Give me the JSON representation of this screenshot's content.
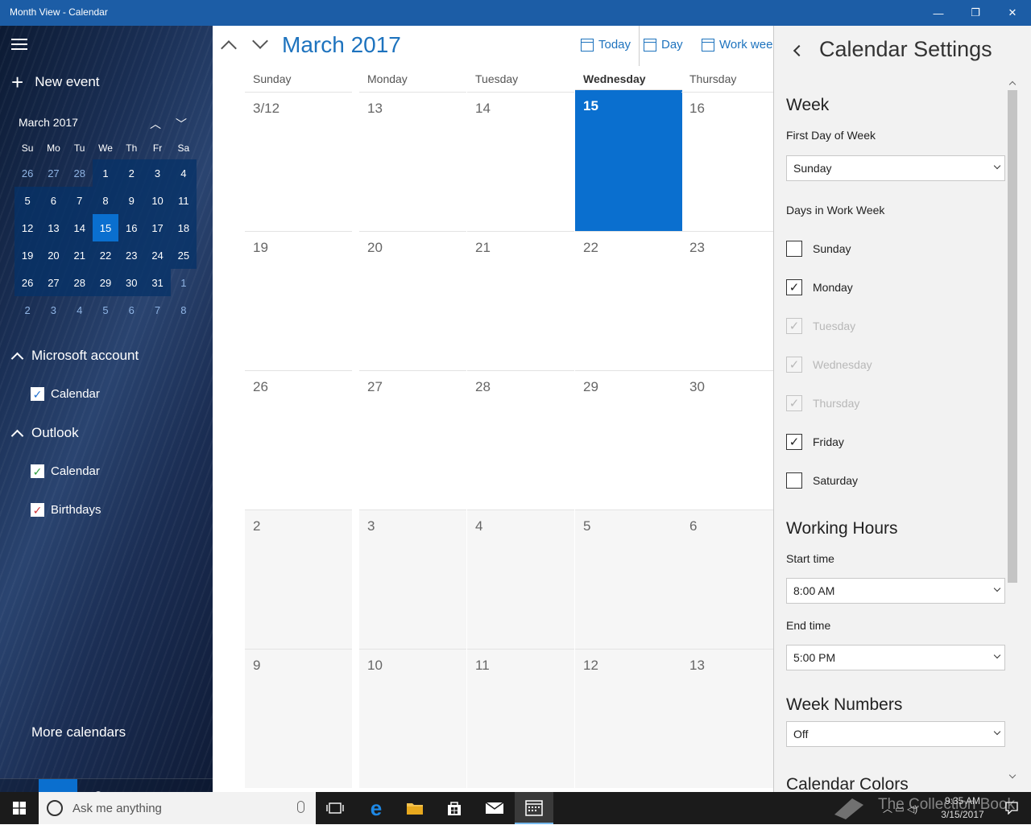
{
  "window": {
    "title": "Month View - Calendar",
    "minimize": "—",
    "restore": "❐",
    "close": "✕"
  },
  "sidebar": {
    "new_event": "New event",
    "mini_calendar": {
      "title": "March 2017",
      "prev": "︿",
      "next": "﹀",
      "weekdays": [
        "Su",
        "Mo",
        "Tu",
        "We",
        "Th",
        "Fr",
        "Sa"
      ],
      "weeks": [
        [
          "26",
          "27",
          "28",
          "1",
          "2",
          "3",
          "4"
        ],
        [
          "5",
          "6",
          "7",
          "8",
          "9",
          "10",
          "11"
        ],
        [
          "12",
          "13",
          "14",
          "15",
          "16",
          "17",
          "18"
        ],
        [
          "19",
          "20",
          "21",
          "22",
          "23",
          "24",
          "25"
        ],
        [
          "26",
          "27",
          "28",
          "29",
          "30",
          "31",
          "1"
        ],
        [
          "2",
          "3",
          "4",
          "5",
          "6",
          "7",
          "8"
        ]
      ]
    },
    "accounts": [
      {
        "name": "Microsoft account",
        "calendars": [
          {
            "label": "Calendar",
            "color": "#1e6fd0"
          }
        ]
      },
      {
        "name": "Outlook",
        "calendars": [
          {
            "label": "Calendar",
            "color": "#2e9e3e"
          },
          {
            "label": "Birthdays",
            "color": "#d13438"
          }
        ]
      }
    ],
    "more_calendars": "More calendars"
  },
  "toolbar": {
    "title": "March 2017",
    "today": "Today",
    "day": "Day",
    "work_week": "Work week"
  },
  "month_grid": {
    "weekdays": [
      "Sunday",
      "Monday",
      "Tuesday",
      "Wednesday",
      "Thursday"
    ],
    "weeks": [
      [
        "3/12",
        "13",
        "14",
        "15",
        "16"
      ],
      [
        "19",
        "20",
        "21",
        "22",
        "23"
      ],
      [
        "26",
        "27",
        "28",
        "29",
        "30"
      ],
      [
        "2",
        "3",
        "4",
        "5",
        "6"
      ],
      [
        "9",
        "10",
        "11",
        "12",
        "13"
      ]
    ]
  },
  "settings": {
    "title": "Calendar Settings",
    "week_heading": "Week",
    "first_day_label": "First Day of Week",
    "first_day_value": "Sunday",
    "work_week_label": "Days in Work Week",
    "work_days": [
      {
        "label": "Sunday",
        "checked": false,
        "disabled": false
      },
      {
        "label": "Monday",
        "checked": true,
        "disabled": false
      },
      {
        "label": "Tuesday",
        "checked": true,
        "disabled": true
      },
      {
        "label": "Wednesday",
        "checked": true,
        "disabled": true
      },
      {
        "label": "Thursday",
        "checked": true,
        "disabled": true
      },
      {
        "label": "Friday",
        "checked": true,
        "disabled": false
      },
      {
        "label": "Saturday",
        "checked": false,
        "disabled": false
      }
    ],
    "working_hours_heading": "Working Hours",
    "start_label": "Start time",
    "start_value": "8:00 AM",
    "end_label": "End time",
    "end_value": "5:00 PM",
    "week_numbers_heading": "Week Numbers",
    "week_numbers_value": "Off",
    "calendar_colors_heading": "Calendar Colors"
  },
  "taskbar": {
    "search_placeholder": "Ask me anything",
    "time": "9:35 AM",
    "date": "3/15/2017",
    "watermark": "The Collection Book"
  }
}
